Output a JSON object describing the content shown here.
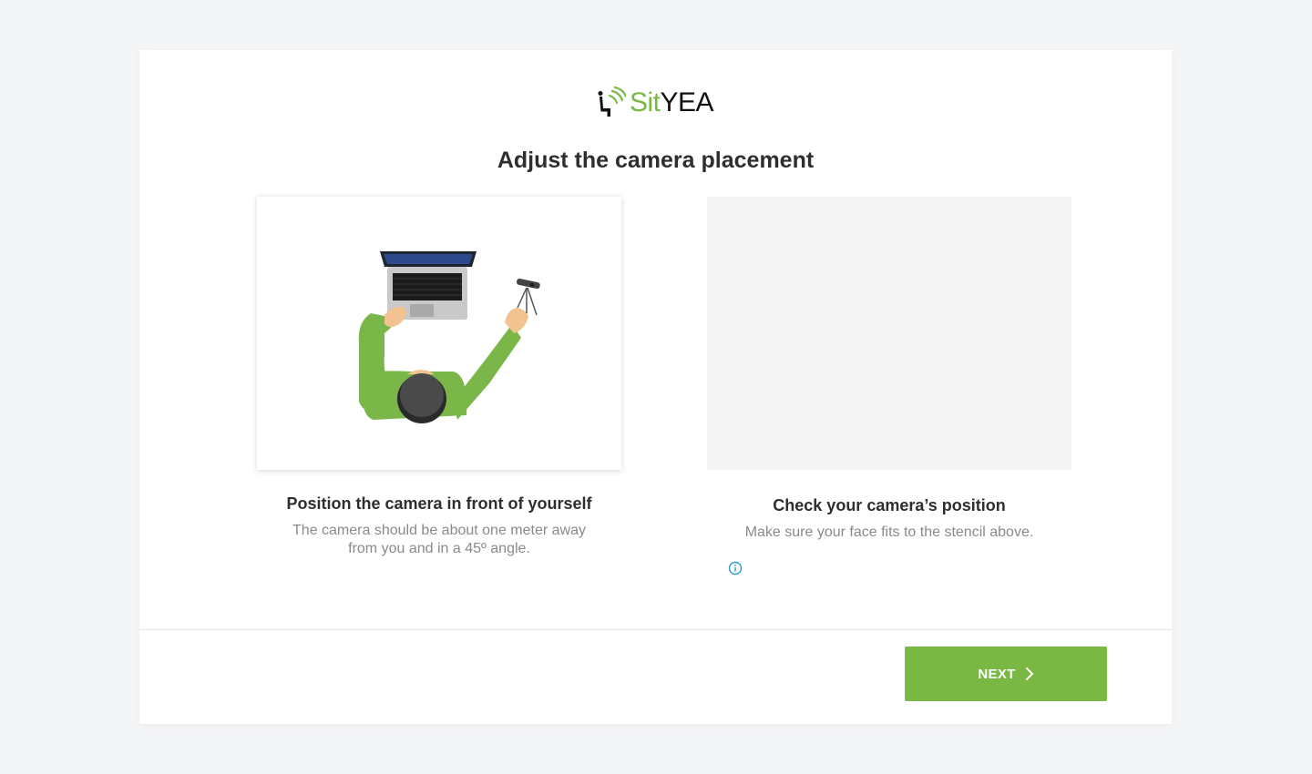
{
  "brand": {
    "name_part1": "Sit",
    "name_part2": "YEA",
    "green": "#78b843",
    "dark": "#111111"
  },
  "page": {
    "title": "Adjust the camera placement"
  },
  "left": {
    "heading": "Position the camera in front of yourself",
    "description_line1": "The camera should be about one meter away",
    "description_line2": "from you and in a 45º angle."
  },
  "right": {
    "heading": "Check your camera’s position",
    "description": "Make sure your face fits to the stencil above.",
    "info_icon": "info-circle-icon"
  },
  "footer": {
    "next_label": "NEXT",
    "next_icon": "chevron-right-icon",
    "button_color": "#78b843"
  },
  "icons": {
    "logo": "sityea-logo-icon",
    "illustration": "person-laptop-camera-illustration"
  }
}
